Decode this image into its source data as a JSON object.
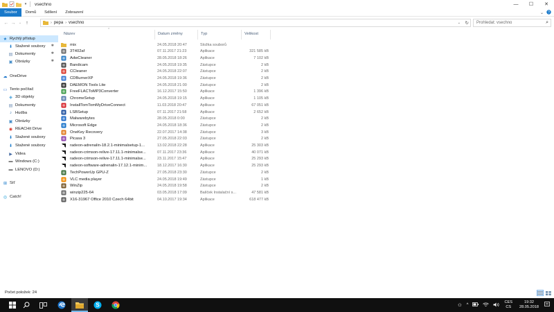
{
  "window": {
    "title": "vsechno",
    "controls": {
      "minimize": "—",
      "maximize": "☐",
      "close": "✕"
    }
  },
  "ribbon": {
    "tabs": [
      "Soubor",
      "Domů",
      "Sdílení",
      "Zobrazení"
    ]
  },
  "address": {
    "path": [
      "pepa",
      "vsechno"
    ],
    "search_placeholder": "Prohledat: vsechno"
  },
  "nav": {
    "items": [
      {
        "label": "Rychlý přístup",
        "icon": "star-icon",
        "selected": true
      },
      {
        "label": "Stažené soubory",
        "icon": "download-icon",
        "pinned": true
      },
      {
        "label": "Dokumenty",
        "icon": "documents-icon",
        "pinned": true
      },
      {
        "label": "Obrázky",
        "icon": "pictures-icon",
        "pinned": true
      },
      {
        "label": "OneDrive",
        "icon": "cloud-icon"
      },
      {
        "label": "Tento počítač",
        "icon": "computer-icon"
      },
      {
        "label": "3D objekty",
        "icon": "cube-icon"
      },
      {
        "label": "Dokumenty",
        "icon": "documents-icon"
      },
      {
        "label": "Hudba",
        "icon": "music-icon"
      },
      {
        "label": "Obrázky",
        "icon": "pictures-icon"
      },
      {
        "label": "REACHit Drive",
        "icon": "reachit-icon"
      },
      {
        "label": "Stažené soubory",
        "icon": "download-icon"
      },
      {
        "label": "Stažené soubory",
        "icon": "download-icon"
      },
      {
        "label": "Videa",
        "icon": "video-icon"
      },
      {
        "label": "Windows (C:)",
        "icon": "drive-icon"
      },
      {
        "label": "LENOVO (D:)",
        "icon": "drive-icon"
      },
      {
        "label": "Síť",
        "icon": "network-icon"
      },
      {
        "label": "Catch!",
        "icon": "catch-icon"
      }
    ]
  },
  "columns": {
    "name": "Název",
    "date": "Datum změny",
    "type": "Typ",
    "size": "Velikost"
  },
  "files": [
    {
      "name": "mix",
      "date": "24.05.2018 20:47",
      "type": "Složka souborů",
      "size": "",
      "icon": "folder-icon",
      "color": "#e8b83a"
    },
    {
      "name": "3T402af",
      "date": "07.11.2017 21:23",
      "type": "Aplikace",
      "size": "321 585 kB",
      "icon": "app-icon",
      "color": "#6b6b6b"
    },
    {
      "name": "AdwCleaner",
      "date": "28.05.2018 18:26",
      "type": "Aplikace",
      "size": "7 102 kB",
      "icon": "adwcleaner-icon",
      "color": "#2e7fc8"
    },
    {
      "name": "Bandicam",
      "date": "24.05.2018 19:35",
      "type": "Zástupce",
      "size": "2 kB",
      "icon": "bandicam-icon",
      "color": "#4a4a4a"
    },
    {
      "name": "CCleaner",
      "date": "24.05.2018 22:07",
      "type": "Zástupce",
      "size": "2 kB",
      "icon": "ccleaner-icon",
      "color": "#d9352a"
    },
    {
      "name": "CDBurnerXP",
      "date": "24.05.2018 19:36",
      "type": "Zástupce",
      "size": "2 kB",
      "icon": "cdburner-icon",
      "color": "#3a7bd5"
    },
    {
      "name": "DAEMON Tools Lite",
      "date": "24.05.2018 21:00",
      "type": "Zástupce",
      "size": "2 kB",
      "icon": "daemon-icon",
      "color": "#2b2b2b"
    },
    {
      "name": "FreeFLACToMP3Converter",
      "date": "16.12.2017 15:50",
      "type": "Aplikace",
      "size": "1 396 kB",
      "icon": "converter-icon",
      "color": "#3c9a48"
    },
    {
      "name": "ChromeSetup",
      "date": "24.05.2018 19:15",
      "type": "Aplikace",
      "size": "1 105 kB",
      "icon": "installer-icon",
      "color": "#5b7fb0"
    },
    {
      "name": "InstallTomTomMyDriveConnect",
      "date": "11.03.2018 20:47",
      "type": "Aplikace",
      "size": "67 051 kB",
      "icon": "tomtom-icon",
      "color": "#d6242c"
    },
    {
      "name": "LSBSetup",
      "date": "07.11.2017 21:58",
      "type": "Aplikace",
      "size": "2 652 kB",
      "icon": "lsb-icon",
      "color": "#1e4f9e"
    },
    {
      "name": "Malwarebytes",
      "date": "28.05.2018 0:00",
      "type": "Zástupce",
      "size": "2 kB",
      "icon": "malwarebytes-icon",
      "color": "#1f6bc9"
    },
    {
      "name": "Microsoft Edge",
      "date": "24.05.2018 18:36",
      "type": "Zástupce",
      "size": "2 kB",
      "icon": "edge-icon",
      "color": "#1a73c9"
    },
    {
      "name": "OneKey Recovery",
      "date": "22.07.2017 14:38",
      "type": "Zástupce",
      "size": "3 kB",
      "icon": "onekey-icon",
      "color": "#e07a1f"
    },
    {
      "name": "Picasa 3",
      "date": "27.05.2018 22:03",
      "type": "Zástupce",
      "size": "2 kB",
      "icon": "picasa-icon",
      "color": "#8e44ad"
    },
    {
      "name": "radeon-adrenalin-18.2.1-minimalsetup-1...",
      "date": "13.02.2018 22:28",
      "type": "Aplikace",
      "size": "25 303 kB",
      "icon": "radeon-icon",
      "color": "#111111"
    },
    {
      "name": "radeon-crimson-relive-17.11.1-minimalse...",
      "date": "07.11.2017 23:36",
      "type": "Aplikace",
      "size": "40 071 kB",
      "icon": "radeon-icon",
      "color": "#111111"
    },
    {
      "name": "radeon-crimson-relive-17.11.1-minimalse...",
      "date": "23.11.2017 15:47",
      "type": "Aplikace",
      "size": "25 293 kB",
      "icon": "radeon-icon",
      "color": "#111111"
    },
    {
      "name": "radeon-software-adrenalin-17.12.1-minim...",
      "date": "18.12.2017 16:30",
      "type": "Aplikace",
      "size": "25 293 kB",
      "icon": "radeon-icon",
      "color": "#111111"
    },
    {
      "name": "TechPowerUp GPU-Z",
      "date": "27.05.2018 23:30",
      "type": "Zástupce",
      "size": "2 kB",
      "icon": "gpuz-icon",
      "color": "#3a6f3a"
    },
    {
      "name": "VLC media player",
      "date": "24.05.2018 19:49",
      "type": "Zástupce",
      "size": "1 kB",
      "icon": "vlc-icon",
      "color": "#f08a00"
    },
    {
      "name": "WinZip",
      "date": "24.05.2018 19:58",
      "type": "Zástupce",
      "size": "2 kB",
      "icon": "winzip-icon",
      "color": "#7a5a2b"
    },
    {
      "name": "winzip225-64",
      "date": "03.05.2018 17:09",
      "type": "Balíček Instalační s...",
      "size": "47 581 kB",
      "icon": "msi-icon",
      "color": "#6b6b6b"
    },
    {
      "name": "X16-31967 Office 2010 Czech 64bit",
      "date": "04.10.2017 19:34",
      "type": "Aplikace",
      "size": "618 477 kB",
      "icon": "app-icon",
      "color": "#5a5a5a"
    }
  ],
  "status": {
    "count": "Počet položek: 24"
  },
  "taskbar": {
    "apps": [
      {
        "name": "windows-start",
        "icon": "windows-icon",
        "active": false
      },
      {
        "name": "search",
        "icon": "search-icon",
        "active": false
      },
      {
        "name": "task-view",
        "icon": "task-view-icon",
        "active": false
      },
      {
        "name": "edge",
        "icon": "edge-icon",
        "active": false
      },
      {
        "name": "file-explorer",
        "icon": "folder-icon",
        "active": true
      },
      {
        "name": "skype",
        "icon": "skype-icon",
        "active": false
      },
      {
        "name": "chrome",
        "icon": "chrome-icon",
        "active": false
      }
    ],
    "lang_top": "CES",
    "lang_bottom": "CS",
    "time": "19:32",
    "date": "28.05.2018"
  }
}
